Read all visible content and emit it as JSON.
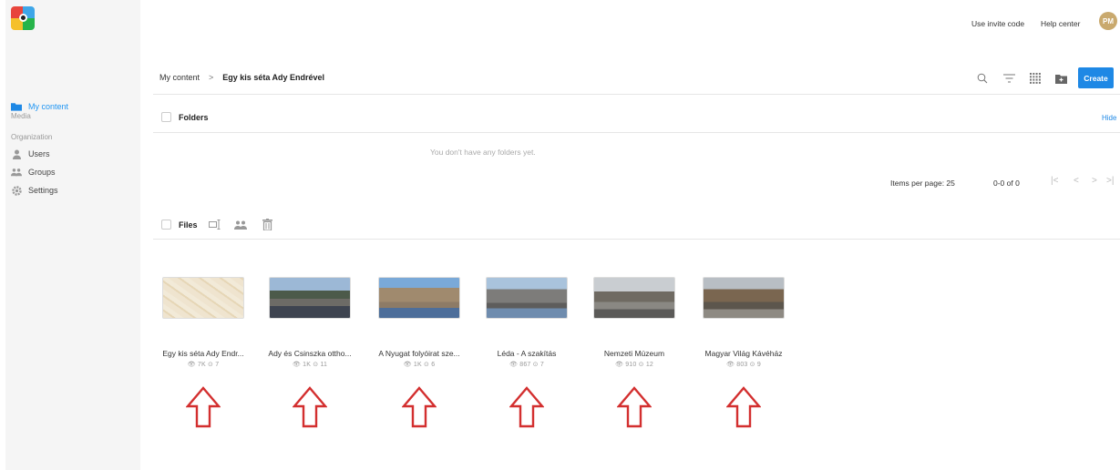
{
  "topbar": {
    "invite_label": "Use invite code",
    "help_label": "Help center",
    "avatar_initials": "PM"
  },
  "sidebar": {
    "media_label": "Media",
    "media_items": [
      {
        "label": "My content",
        "icon": "folder-icon"
      }
    ],
    "org_label": "Organization",
    "org_items": [
      {
        "label": "Users",
        "icon": "user-icon"
      },
      {
        "label": "Groups",
        "icon": "groups-icon"
      },
      {
        "label": "Settings",
        "icon": "gear-icon"
      }
    ]
  },
  "breadcrumb": {
    "root": "My content",
    "separator": ">",
    "current": "Egy kis séta Ady Endrével"
  },
  "toolbar": {
    "create_label": "Create",
    "accent": "#1e88e5"
  },
  "folders": {
    "title": "Folders",
    "hide_label": "Hide",
    "empty_message": "You don't have any folders yet."
  },
  "pagination": {
    "items_per_page_label": "Items per page: 25",
    "range_label": "0-0 of 0"
  },
  "files": {
    "title": "Files",
    "items": [
      {
        "title": "Egy kis séta Ady Endr...",
        "stats": "👁 7K ⊙ 7"
      },
      {
        "title": "Ady és Csinszka ottho...",
        "stats": "👁 1K ⊙ 11"
      },
      {
        "title": "A Nyugat folyóirat sze...",
        "stats": "👁 1K ⊙ 6"
      },
      {
        "title": "Léda - A szakítás",
        "stats": "👁 867 ⊙ 7"
      },
      {
        "title": "Nemzeti Múzeum",
        "stats": "👁 910 ⊙ 12"
      },
      {
        "title": "Magyar Világ Kávéház",
        "stats": "👁 803 ⊙ 9"
      }
    ]
  },
  "annotation_color": "#d32f2f"
}
